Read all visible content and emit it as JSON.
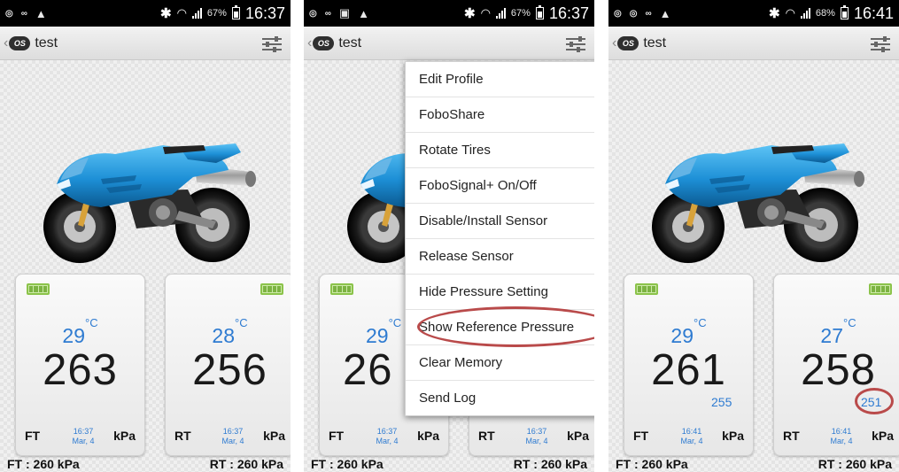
{
  "status_bars": [
    {
      "time": "16:37",
      "battery": "67%"
    },
    {
      "time": "16:37",
      "battery": "67%"
    },
    {
      "time": "16:41",
      "battery": "68%"
    }
  ],
  "app": {
    "logo_text": "OS",
    "profile_name": "test"
  },
  "screens": [
    {
      "front": {
        "position": "FT",
        "temp": "29",
        "temp_unit": "°C",
        "pressure": "263",
        "date": "16:37",
        "date2": "Mar, 4",
        "unit": "kPa"
      },
      "rear": {
        "position": "RT",
        "temp": "28",
        "temp_unit": "°C",
        "pressure": "256",
        "date": "16:37",
        "date2": "Mar, 4",
        "unit": "kPa"
      },
      "front_setpoint": "FT : 260 kPa",
      "rear_setpoint": "RT : 260 kPa"
    },
    {
      "front": {
        "position": "FT",
        "temp": "29",
        "temp_unit": "°C",
        "pressure": "26",
        "date": "16:37",
        "date2": "Mar, 4",
        "unit": "kPa"
      },
      "rear": {
        "position": "RT",
        "temp": "",
        "temp_unit": "",
        "pressure": "",
        "date": "16:37",
        "date2": "Mar, 4",
        "unit": "kPa"
      },
      "front_setpoint": "FT : 260 kPa",
      "rear_setpoint": "RT : 260 kPa",
      "menu": [
        "Edit Profile",
        "FoboShare",
        "Rotate Tires",
        "FoboSignal+ On/Off",
        "Disable/Install Sensor",
        "Release Sensor",
        "Hide Pressure Setting",
        "Show Reference Pressure",
        "Clear Memory",
        "Send Log"
      ]
    },
    {
      "front": {
        "position": "FT",
        "temp": "29",
        "temp_unit": "°C",
        "pressure": "261",
        "reference": "255",
        "date": "16:41",
        "date2": "Mar, 4",
        "unit": "kPa"
      },
      "rear": {
        "position": "RT",
        "temp": "27",
        "temp_unit": "°C",
        "pressure": "258",
        "reference": "251",
        "date": "16:41",
        "date2": "Mar, 4",
        "unit": "kPa"
      },
      "front_setpoint": "FT : 260 kPa",
      "rear_setpoint": "RT : 260 kPa"
    }
  ],
  "colors": {
    "accent_blue": "#2e7bd1",
    "highlight_red": "#b94a4a",
    "battery_green": "#7cb342",
    "bike_blue": "#1d8fd6"
  },
  "icons": [
    "back-chevron-icon",
    "fobo-logo-icon",
    "settings-sliders-icon",
    "sensor-battery-icon",
    "bluetooth-icon",
    "wifi-icon",
    "signal-icon",
    "phone-battery-icon"
  ]
}
